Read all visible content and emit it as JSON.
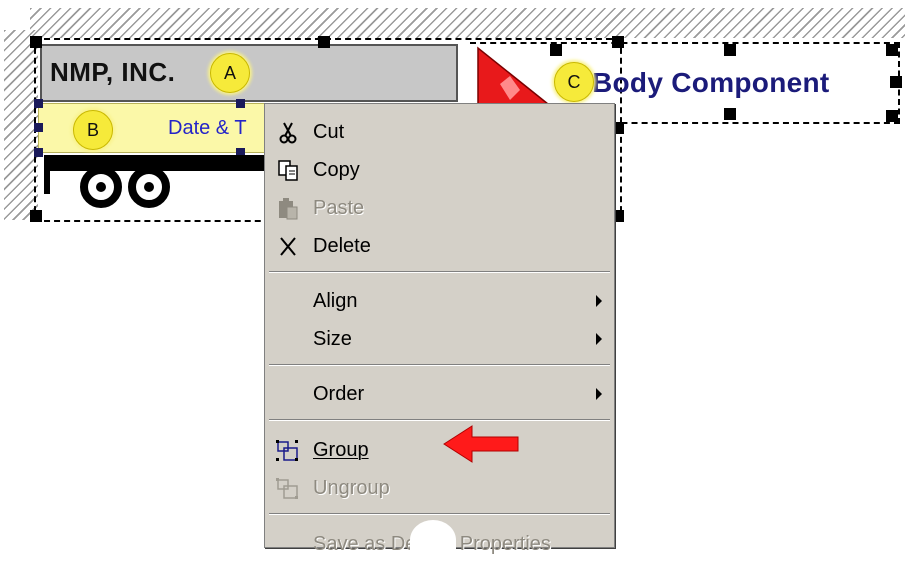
{
  "canvas": {
    "title_text": "NMP, INC.",
    "date_text": "Date & T",
    "body_component_text": "Body Component",
    "callouts": {
      "a": "A",
      "b": "B",
      "c": "C"
    }
  },
  "context_menu": {
    "items": [
      {
        "label": "Cut",
        "icon": "scissors-icon",
        "enabled": true
      },
      {
        "label": "Copy",
        "icon": "copy-icon",
        "enabled": true
      },
      {
        "label": "Paste",
        "icon": "paste-icon",
        "enabled": false
      },
      {
        "label": "Delete",
        "icon": "delete-x-icon",
        "enabled": true
      },
      {
        "label": "Align",
        "submenu": true,
        "enabled": true
      },
      {
        "label": "Size",
        "submenu": true,
        "enabled": true
      },
      {
        "label": "Order",
        "submenu": true,
        "enabled": true
      },
      {
        "label": "Group",
        "icon": "group-icon",
        "enabled": true,
        "mnemonic": "G"
      },
      {
        "label": "Ungroup",
        "icon": "ungroup-icon",
        "enabled": false
      },
      {
        "label": "Save as Default Properties",
        "enabled": false
      }
    ]
  },
  "colors": {
    "menu_bg": "#d4d0c8",
    "callout_fill": "#f6ea3a",
    "annotation_arrow": "#ff1a1a",
    "body_text": "#1b1b7a",
    "date_text": "#2424c8"
  }
}
